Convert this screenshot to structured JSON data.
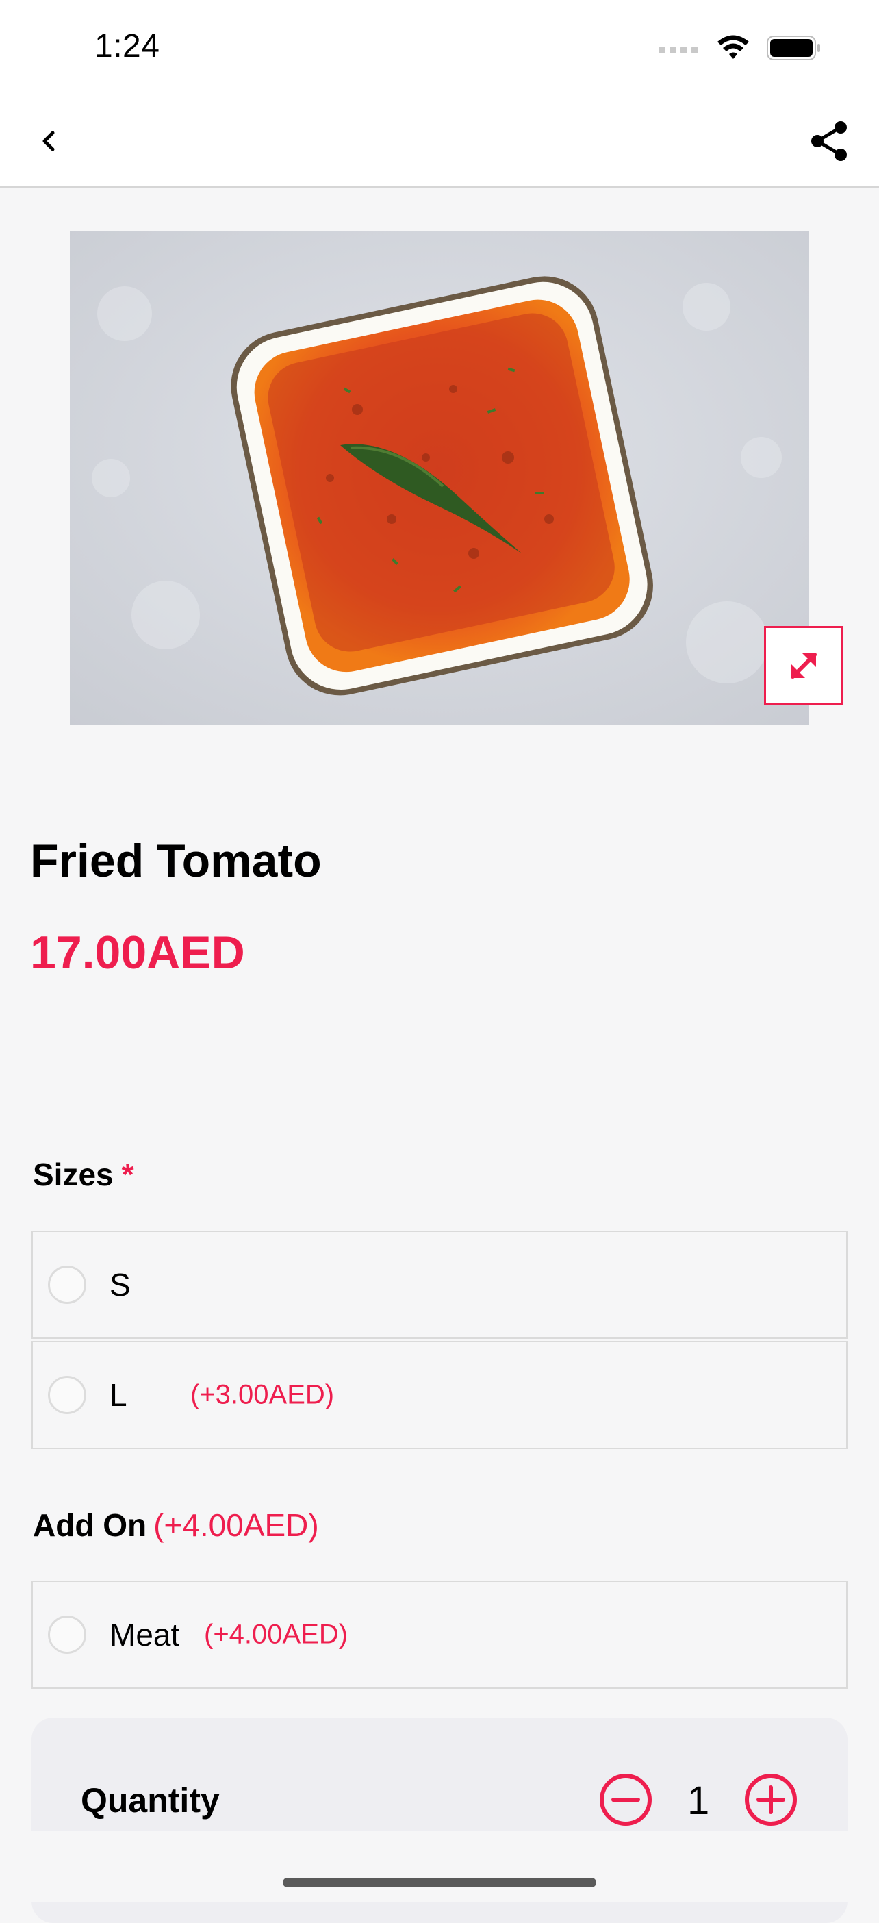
{
  "status": {
    "time": "1:24"
  },
  "product": {
    "title": "Fried Tomato",
    "price": "17.00AED"
  },
  "sizes": {
    "title": "Sizes",
    "required_mark": "*",
    "options": [
      {
        "label": "S",
        "price": ""
      },
      {
        "label": "L",
        "price": "(+3.00AED)"
      }
    ]
  },
  "addon": {
    "title": "Add On",
    "extra": "(+4.00AED)",
    "options": [
      {
        "label": "Meat",
        "price": "(+4.00AED)"
      }
    ]
  },
  "quantity": {
    "label": "Quantity",
    "value": "1"
  },
  "colors": {
    "accent": "#ee1e4e",
    "background": "#f6f6f7"
  },
  "icons": {
    "back": "chevron-left-icon",
    "share": "share-icon",
    "expand": "expand-icon",
    "minus": "minus-circle-icon",
    "plus": "plus-circle-icon"
  }
}
